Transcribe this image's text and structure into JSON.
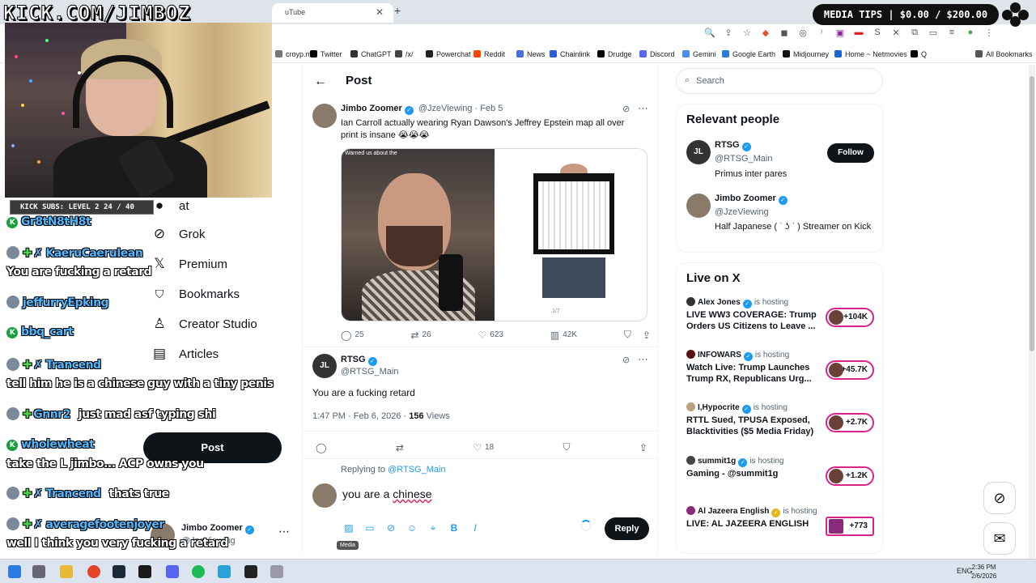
{
  "overlay": {
    "banner": "KICK.COM/JIMBOZ",
    "media_tips": "MEDIA TIPS | $0.00 / $200.00",
    "subs": "KICK SUBS: LEVEL 2 24 / 40"
  },
  "browser": {
    "tab_title": "uTube",
    "bookmarks": [
      {
        "label": "croyp.me",
        "color": "#777"
      },
      {
        "label": "Twitter",
        "color": "#000"
      },
      {
        "label": "ChatGPT",
        "color": "#333"
      },
      {
        "label": "/x/",
        "color": "#444"
      },
      {
        "label": "Powerchat",
        "color": "#222"
      },
      {
        "label": "Reddit",
        "color": "#ff4500"
      },
      {
        "label": "News",
        "color": "#4a6ee0"
      },
      {
        "label": "Chainlink",
        "color": "#2a5ada"
      },
      {
        "label": "Drudge",
        "color": "#000"
      },
      {
        "label": "Discord",
        "color": "#5865f2"
      },
      {
        "label": "Gemini",
        "color": "#4a8bf0"
      },
      {
        "label": "Google Earth",
        "color": "#2a7ae2"
      },
      {
        "label": "Midjourney",
        "color": "#111"
      },
      {
        "label": "Home ~ Netmovies",
        "color": "#1a66d6"
      },
      {
        "label": "Q",
        "color": "#000"
      },
      {
        "label": "All Bookmarks",
        "color": "#555"
      }
    ]
  },
  "chat": [
    {
      "user": "Gr8tN8tH8t",
      "msg": "",
      "style": "kick"
    },
    {
      "user": "KaeruCaeruIean",
      "msg": "",
      "style": "plus"
    },
    {
      "user": "",
      "msg": "You are fucking a retard",
      "style": "msg"
    },
    {
      "user": "jeffurryEpking",
      "msg": "",
      "style": "avatar"
    },
    {
      "user": "bbq_cart",
      "msg": "",
      "style": "kick"
    },
    {
      "user": "Trancend",
      "msg": "",
      "style": "plus"
    },
    {
      "user": "",
      "msg": "tell him he is a chinese guy with a tiny penis",
      "style": "msg"
    },
    {
      "user": "Gnnr2",
      "msg": "just mad asf typing shi",
      "style": "plus-avatar"
    },
    {
      "user": "wholewheat",
      "msg": "",
      "style": "kick"
    },
    {
      "user": "",
      "msg": "take the L jimbo... ACP owns you",
      "style": "msg"
    },
    {
      "user": "Trancend",
      "msg": "thats true",
      "style": "plus"
    },
    {
      "user": "averagefootenjoyer",
      "msg": "",
      "style": "plus"
    },
    {
      "user": "",
      "msg": "well I think you very fucking a retard",
      "style": "msg"
    }
  ],
  "nav": {
    "items": [
      {
        "label": "Grok",
        "icon": "grok-icon",
        "glyph": "⊘"
      },
      {
        "label": "Premium",
        "icon": "x-logo-icon",
        "glyph": "𝕏"
      },
      {
        "label": "Bookmarks",
        "icon": "bookmark-icon",
        "glyph": "🔖"
      },
      {
        "label": "Creator Studio",
        "icon": "creator-studio-icon",
        "glyph": "♙"
      },
      {
        "label": "Articles",
        "icon": "articles-icon",
        "glyph": "▤"
      }
    ],
    "partial_top": "at",
    "post_label": "Post",
    "account_name": "Jimbo Zoomer",
    "account_handle": "@JzeViewing"
  },
  "main": {
    "title": "Post",
    "tweet1": {
      "name": "Jimbo Zoomer",
      "handle": "@JzeViewing",
      "date": "· Feb 5",
      "text": "Ian Carroll actually wearing Ryan Dawson's Jeffrey Epstein map all over print is insane 😭😭😭",
      "media_caption": "Warned us about the",
      "pager": "1/7",
      "replies": "25",
      "reposts": "26",
      "likes": "623",
      "views": "42K"
    },
    "tweet2": {
      "name": "RTSG",
      "handle": "@RTSG_Main",
      "text": "You are a fucking retard",
      "timestamp": "1:47 PM · Feb 6, 2026 · ",
      "views_count": "156",
      "views_label": " Views",
      "likes": "18"
    },
    "reply": {
      "replying_to": "Replying to ",
      "replying_handle": "@RTSG_Main",
      "draft_prefix": "you are a ",
      "draft_word": "chinese",
      "media_tooltip": "Media",
      "reply_label": "Reply"
    }
  },
  "sidebar": {
    "search_placeholder": "Search",
    "relevant_title": "Relevant people",
    "people": [
      {
        "name": "RTSG",
        "handle": "@RTSG_Main",
        "bio": "Primus inter pares",
        "follow": "Follow"
      },
      {
        "name": "Jimbo Zoomer",
        "handle": "@JzeViewing",
        "bio": "Half Japanese ( ˈ ʖ ˈ ) Streamer on Kick"
      }
    ],
    "live_title": "Live on X",
    "live": [
      {
        "host": "Alex Jones",
        "hosting": "is hosting",
        "title": "LIVE WW3 COVERAGE: Trump Orders US Citizens to Leave ...",
        "count": "+104K"
      },
      {
        "host": "INFOWARS",
        "hosting": "is hosting",
        "title": "Watch Live: Trump Launches Trump RX, Republicans Urg...",
        "count": "+45.7K"
      },
      {
        "host": "I,Hypocrite",
        "hosting": "is hosting",
        "title": "RTTL Sued, TPUSA Exposed, Blacktivities ($5 Media Friday)",
        "count": "+2.7K"
      },
      {
        "host": "summit1g",
        "hosting": "is hosting",
        "title": "Gaming - @summit1g",
        "count": "+1.2K"
      },
      {
        "host": "Al Jazeera English",
        "hosting": "is hosting",
        "title": "LIVE: AL JAZEERA ENGLISH",
        "count": "+773"
      }
    ]
  },
  "taskbar": {
    "lang": "ENG",
    "time": "2:36 PM",
    "date": "2/6/2026"
  }
}
